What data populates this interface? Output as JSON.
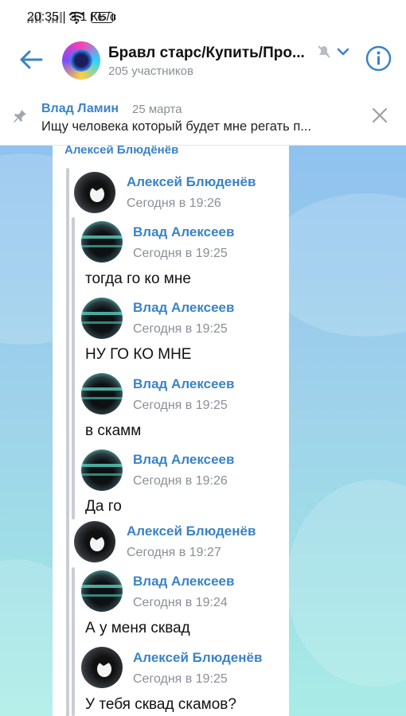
{
  "status_bar": {
    "time": "20:35 | 3,1 КБ/с",
    "battery": "65"
  },
  "header": {
    "title": "Бравл старс/Купить/Про...",
    "subtitle": "205 участников",
    "icons": {
      "back": "arrow-left-icon",
      "mute": "muted-icon",
      "dropdown": "chevron-down-icon",
      "info": "info-icon"
    }
  },
  "pinned": {
    "author": "Влад Ламин",
    "date": "25 марта",
    "text": "Ищу человека который будет мне регать п..."
  },
  "message": {
    "sender": "Алексей Блюдёнёв",
    "forwarded": [
      {
        "name": "Алексей Блюденёв",
        "time": "Сегодня в 19:26"
      },
      {
        "name": "Влад Алексеев",
        "time": "Сегодня в 19:25",
        "text": "тогда го ко мне"
      },
      {
        "name": "Влад Алексеев",
        "time": "Сегодня в 19:25",
        "text": "НУ ГО КО МНЕ"
      },
      {
        "name": "Влад Алексеев",
        "time": "Сегодня в 19:25",
        "text": "в скамм"
      },
      {
        "name": "Влад Алексеев",
        "time": "Сегодня в 19:26",
        "text": "Да го"
      },
      {
        "name": "Алексей Блюденёв",
        "time": "Сегодня в 19:27"
      },
      {
        "name": "Влад Алексеев",
        "time": "Сегодня в 19:24",
        "text": "А у меня сквад"
      },
      {
        "name": "Алексей Блюденёв",
        "time": "Сегодня в 19:25",
        "text": "У тебя сквад скамов?"
      }
    ]
  }
}
